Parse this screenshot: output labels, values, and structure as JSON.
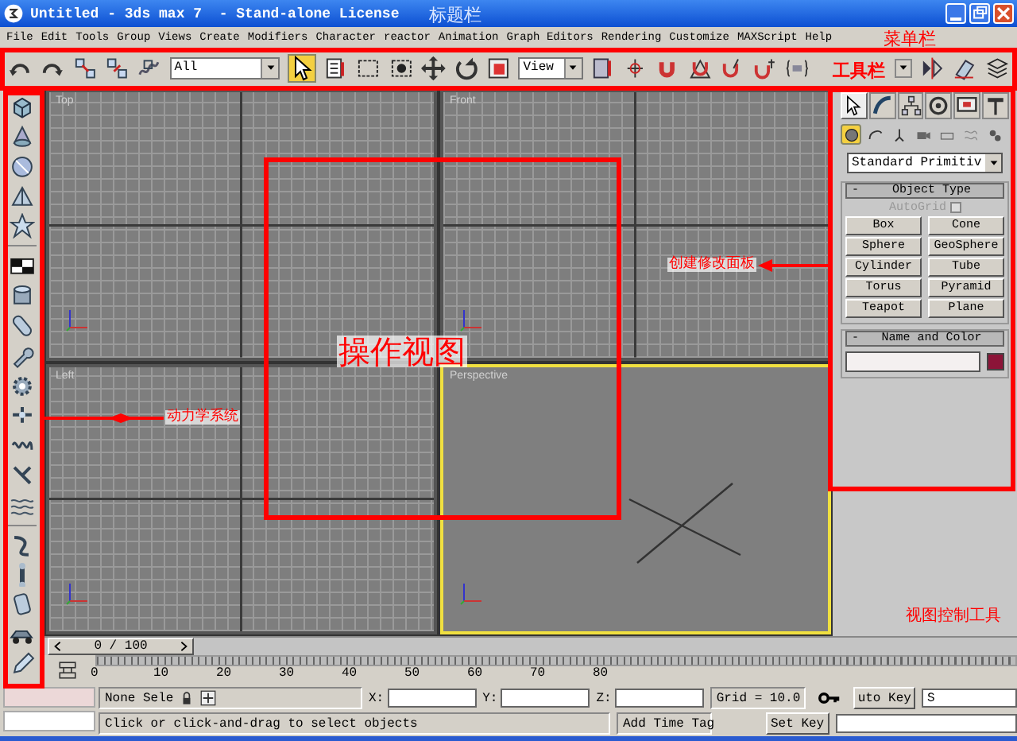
{
  "window": {
    "title": "Untitled - 3ds max 7  - Stand-alone License"
  },
  "menu_bar": {
    "items": [
      "File",
      "Edit",
      "Tools",
      "Group",
      "Views",
      "Create",
      "Modifiers",
      "Character",
      "reactor",
      "Animation",
      "Graph Editors",
      "Rendering",
      "Customize",
      "MAXScript",
      "Help"
    ]
  },
  "toolbar": {
    "selection_filter": "All",
    "reference_coord": "View",
    "select_active": true
  },
  "command_panel": {
    "tabs": [
      {
        "selected": true
      },
      {
        "selected": false
      },
      {
        "selected": false
      },
      {
        "selected": false
      },
      {
        "selected": false
      },
      {
        "selected": false
      }
    ],
    "categories": [
      {
        "selected": true
      },
      {
        "selected": false
      },
      {
        "selected": false
      },
      {
        "selected": false
      },
      {
        "selected": false
      },
      {
        "selected": false
      },
      {
        "selected": false
      }
    ],
    "category_dropdown": "Standard Primitiv",
    "object_type": {
      "collapse_sign": "-",
      "title": "Object Type",
      "autogrid": {
        "label": "AutoGrid",
        "checked": false,
        "disabled": true
      },
      "buttons": [
        "Box",
        "Cone",
        "Sphere",
        "GeoSphere",
        "Cylinder",
        "Tube",
        "Torus",
        "Pyramid",
        "Teapot",
        "Plane"
      ]
    },
    "name_and_color": {
      "collapse_sign": "-",
      "title": "Name and Color",
      "color": "#8c1438"
    }
  },
  "viewports": [
    {
      "label": "Top",
      "active": false
    },
    {
      "label": "Front",
      "active": false
    },
    {
      "label": "Left",
      "active": false
    },
    {
      "label": "Perspective",
      "active": true
    }
  ],
  "time_slider": {
    "text": "0 / 100",
    "level": 0
  },
  "track_bar": {
    "ticks": [
      "0",
      "10",
      "20",
      "30",
      "40",
      "50",
      "60",
      "70",
      "80"
    ]
  },
  "status_bar": {
    "selection": "None Sele",
    "x_label": "X:",
    "y_label": "Y:",
    "z_label": "Z:",
    "grid": "Grid = 10.0",
    "prompt": "Click or click-and-drag to select objects",
    "add_time_tag": "Add Time Tag",
    "auto_key": "uto Key",
    "key_mode": "S",
    "set_key": "Set Key"
  },
  "annotations": {
    "title_bar": "标题栏",
    "menu_bar": "菜单栏",
    "toolbar": "工具栏",
    "viewports": "操作视图",
    "command_panel": "创建修改面板",
    "dynamics": "动力学系统",
    "view_controls": "视图控制工具"
  }
}
